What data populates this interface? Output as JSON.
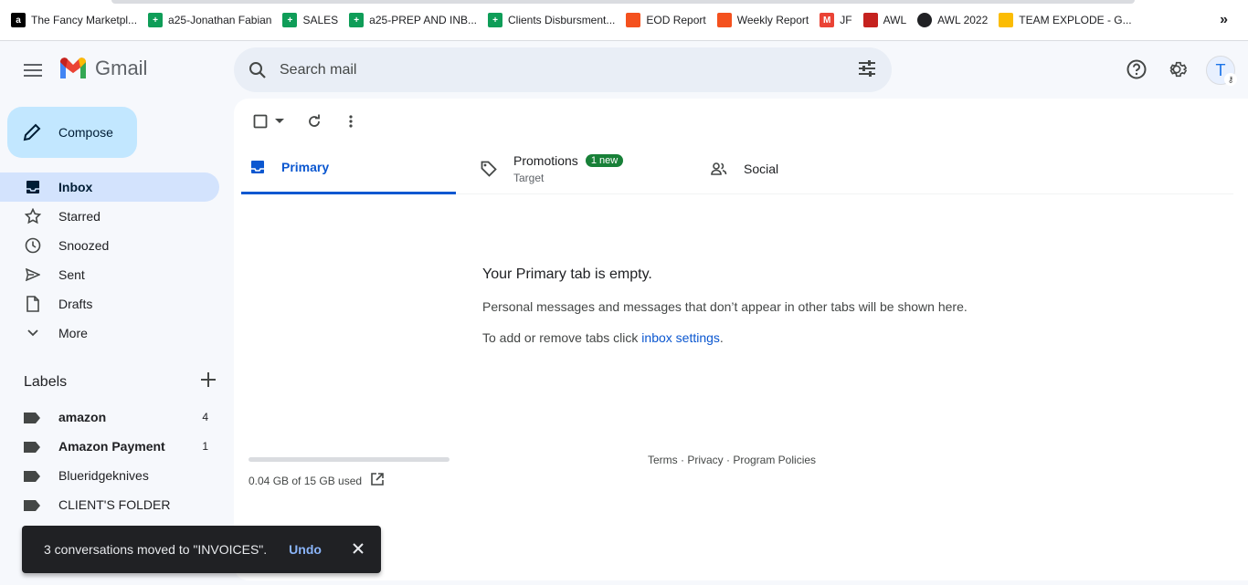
{
  "bookmarks": [
    {
      "label": "The Fancy Marketpl...",
      "icon": "amazon-icon",
      "color": "#000000"
    },
    {
      "label": "a25-Jonathan Fabian",
      "icon": "sheets-icon",
      "color": "#0f9d58"
    },
    {
      "label": "SALES",
      "icon": "sheets-icon",
      "color": "#0f9d58"
    },
    {
      "label": "a25-PREP AND INB...",
      "icon": "sheets-icon",
      "color": "#0f9d58"
    },
    {
      "label": "Clients Disbursment...",
      "icon": "sheets-icon",
      "color": "#0f9d58"
    },
    {
      "label": "EOD Report",
      "icon": "report-icon",
      "color": "#f4511e"
    },
    {
      "label": "Weekly Report",
      "icon": "report-icon",
      "color": "#f4511e"
    },
    {
      "label": "JF",
      "icon": "gmail-icon",
      "color": "#ea4335"
    },
    {
      "label": "AWL",
      "icon": "awl-icon",
      "color": "#c5221f"
    },
    {
      "label": "AWL 2022",
      "icon": "globe-icon",
      "color": "#202124"
    },
    {
      "label": "TEAM EXPLODE - G...",
      "icon": "drive-icon",
      "color": "#fbbc04"
    }
  ],
  "header": {
    "app_name": "Gmail",
    "search_placeholder": "Search mail",
    "avatar_letter": "T"
  },
  "compose_label": "Compose",
  "nav": [
    {
      "label": "Inbox",
      "icon": "inbox-icon",
      "active": true
    },
    {
      "label": "Starred",
      "icon": "star-icon"
    },
    {
      "label": "Snoozed",
      "icon": "clock-icon"
    },
    {
      "label": "Sent",
      "icon": "send-icon"
    },
    {
      "label": "Drafts",
      "icon": "draft-icon"
    },
    {
      "label": "More",
      "icon": "chevron-down-icon"
    }
  ],
  "labels_title": "Labels",
  "labels": [
    {
      "label": "amazon",
      "count": "4",
      "bold": true
    },
    {
      "label": "Amazon Payment",
      "count": "1",
      "bold": true
    },
    {
      "label": "Blueridgeknives",
      "count": ""
    },
    {
      "label": "CLIENT'S FOLDER",
      "count": ""
    }
  ],
  "tabs": {
    "primary": "Primary",
    "promotions": "Promotions",
    "promotions_badge": "1 new",
    "promotions_sub": "Target",
    "social": "Social"
  },
  "empty": {
    "title": "Your Primary tab is empty.",
    "line1": "Personal messages and messages that don’t appear in other tabs will be shown here.",
    "line2_prefix": "To add or remove tabs click ",
    "line2_link": "inbox settings",
    "line2_suffix": "."
  },
  "storage_text": "0.04 GB of 15 GB used",
  "footer": "Terms · Privacy · Program Policies",
  "snackbar": {
    "message": "3 conversations moved to \"INVOICES\".",
    "undo": "Undo"
  },
  "colors": {
    "accent": "#0b57d0",
    "compose_bg": "#c2e7ff",
    "active_nav": "#d3e3fd",
    "badge_green": "#188038"
  }
}
